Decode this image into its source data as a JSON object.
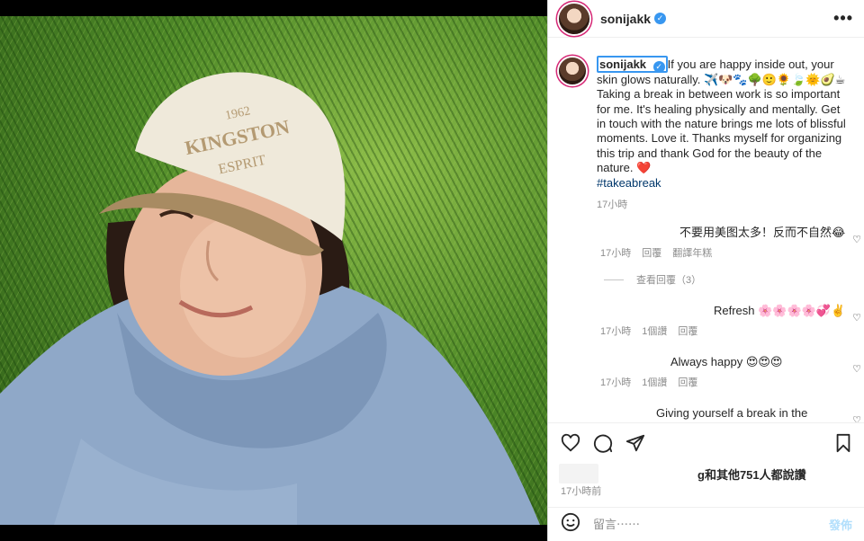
{
  "post": {
    "username": "sonijakk",
    "more_icon": "more-options-icon",
    "photo_cap_text": "KINGSTON",
    "photo_cap_line1": "1962",
    "photo_cap_line3": "ESPRIT"
  },
  "caption": {
    "username": "sonijakk",
    "text": "If you are happy inside out, your skin glows naturally. ✈️🐶🐾🌳🙂🌻🍃🌞🥑☕Taking a break in between work is so important for me. It's healing physically and mentally. Get in touch with the nature brings me lots of blissful moments. Love it. Thanks myself for organizing this trip and thank God for the beauty of the nature. ❤️",
    "hashtag": "#takeabreak",
    "time": "17小時"
  },
  "comments": [
    {
      "text": "不要用美图太多！反而不自然😂",
      "time": "17小時",
      "actions": [
        "回覆",
        "翻譯年糕"
      ]
    },
    {
      "text": "Refresh 🌸🌸🌸🌸💞✌️",
      "time": "17小時",
      "actions": [
        "1個讚",
        "回覆"
      ]
    },
    {
      "text": "Always happy 😍😍😍",
      "time": "17小時",
      "actions": [
        "1個讚",
        "回覆"
      ]
    },
    {
      "text": "Giving yourself a break in the",
      "time": "",
      "actions": []
    }
  ],
  "view_replies": "查看回覆（3）",
  "likes_text": "g和其他751人都說讚",
  "posted_time": "17小時前",
  "comment_box": {
    "placeholder": "留言⋯⋯",
    "post_label": "發佈"
  },
  "colors": {
    "accent": "#3897f0",
    "link": "#00376b",
    "muted": "#8e8e8e"
  }
}
